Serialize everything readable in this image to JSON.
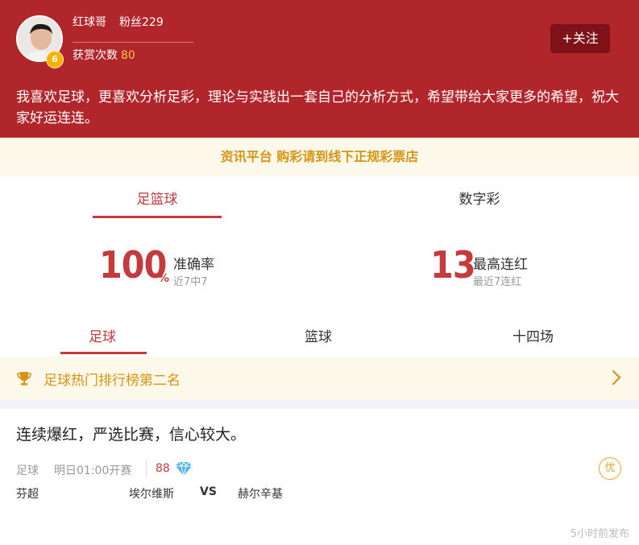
{
  "profile": {
    "name": "红球哥",
    "fans": "粉丝229",
    "level": "6",
    "reward_label": "获赏次数",
    "reward_count": "80",
    "follow_label": "+关注",
    "bio": "我喜欢足球，更喜欢分析足彩，理论与实践出一套自己的分析方式，希望带给大家更多的希望，祝大家好运连连。"
  },
  "notice": "资讯平台 购彩请到线下正规彩票店",
  "top_tabs": [
    {
      "label": "足篮球",
      "active": true
    },
    {
      "label": "数字彩",
      "active": false
    }
  ],
  "stats": {
    "accuracy_value": "100",
    "accuracy_unit": "%",
    "accuracy_label": "准确率",
    "accuracy_sub": "近7中7",
    "streak_value": "13",
    "streak_label": "最高连红",
    "streak_sub": "最近7连红"
  },
  "sub_tabs": [
    {
      "label": "足球",
      "active": true
    },
    {
      "label": "篮球",
      "active": false
    },
    {
      "label": "十四场",
      "active": false
    }
  ],
  "ranking": {
    "text": "足球热门排行榜第二名",
    "icon": "trophy-icon"
  },
  "post": {
    "title": "连续爆红，严选比赛，信心较大。",
    "sport": "足球",
    "kickoff": "明日01:00开赛",
    "price": "88",
    "badge": "优",
    "league": "芬超",
    "home": "埃尔维斯",
    "vs": "VS",
    "away": "赫尔辛基",
    "published": "5小时前发布"
  },
  "colors": {
    "brand_red": "#b1262b",
    "accent_red": "#c43a3d",
    "gold": "#d69412",
    "notice_bg": "#fdf9ea"
  }
}
